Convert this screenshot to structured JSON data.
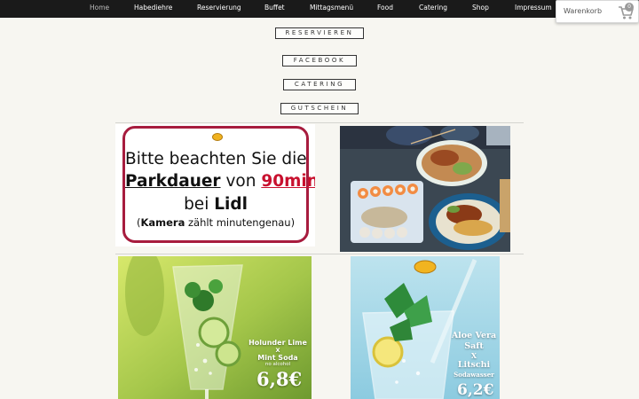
{
  "nav": {
    "items": [
      {
        "label": "Home",
        "active": true
      },
      {
        "label": "Habediehre"
      },
      {
        "label": "Reservierung"
      },
      {
        "label": "Buffet"
      },
      {
        "label": "Mittagsmenü"
      },
      {
        "label": "Food"
      },
      {
        "label": "Catering"
      },
      {
        "label": "Shop"
      },
      {
        "label": "Impressum"
      }
    ]
  },
  "cart": {
    "label": "Warenkorb",
    "count": "0",
    "icon": "shopping-cart-icon"
  },
  "buttons": {
    "reservieren": "RESERVIEREN",
    "facebook": "FACEBOOK",
    "catering": "CATERING",
    "gutschein": "GUTSCHEIN"
  },
  "notice": {
    "line1": "Bitte beachten Sie die",
    "parkdauer": "Parkdauer",
    "von": "von",
    "minutes": "90min",
    "bei": "bei",
    "lidl": "Lidl",
    "open_paren": "(",
    "kamera": "Kamera",
    "rest": "zählt minutengenau)"
  },
  "food_photo": {
    "icon": "food-plates-photo"
  },
  "drink1": {
    "name_line1": "Holunder Lime",
    "name_x": "X",
    "name_line2": "Mint Soda",
    "note": "no alcohol",
    "price": "6,8€"
  },
  "drink2": {
    "name_line1": "Aloe Vera",
    "name_line2": "Saft",
    "name_x": "X",
    "name_line3": "Litschi",
    "name_line4": "Sodawasser",
    "price": "6,2€"
  },
  "colors": {
    "nav_bg": "#1a1a1a",
    "page_bg": "#f7f6f1",
    "notice_border": "#a71c3e",
    "notice_accent": "#c8102e"
  }
}
